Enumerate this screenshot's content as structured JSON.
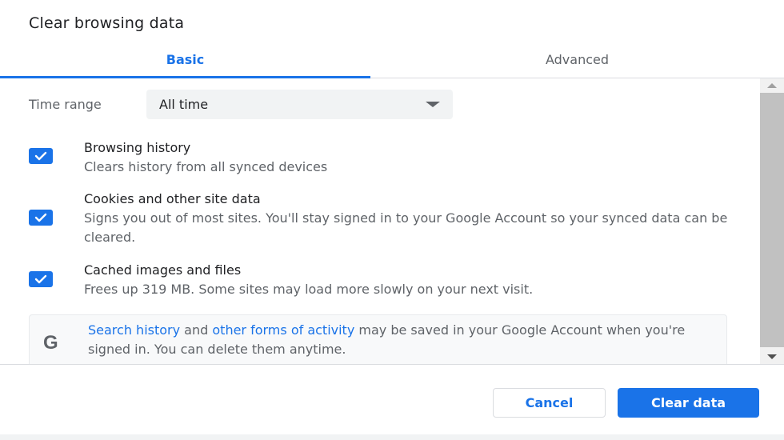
{
  "dialog": {
    "title": "Clear browsing data"
  },
  "tabs": [
    {
      "label": "Basic",
      "active": true
    },
    {
      "label": "Advanced",
      "active": false
    }
  ],
  "time_range": {
    "label": "Time range",
    "selected": "All time"
  },
  "options": [
    {
      "title": "Browsing history",
      "description": "Clears history from all synced devices",
      "checked": true
    },
    {
      "title": "Cookies and other site data",
      "description": "Signs you out of most sites. You'll stay signed in to your Google Account so your synced data can be cleared.",
      "checked": true
    },
    {
      "title": "Cached images and files",
      "description": "Frees up 319 MB. Some sites may load more slowly on your next visit.",
      "checked": true
    }
  ],
  "info": {
    "icon": "google-g-icon",
    "link1": "Search history",
    "text1": " and ",
    "link2": "other forms of activity",
    "text2": " may be saved in your Google Account when you're signed in. You can delete them anytime."
  },
  "buttons": {
    "cancel": "Cancel",
    "clear": "Clear data"
  },
  "colors": {
    "accent": "#1a73e8",
    "text_primary": "#202124",
    "text_secondary": "#5f6368"
  }
}
